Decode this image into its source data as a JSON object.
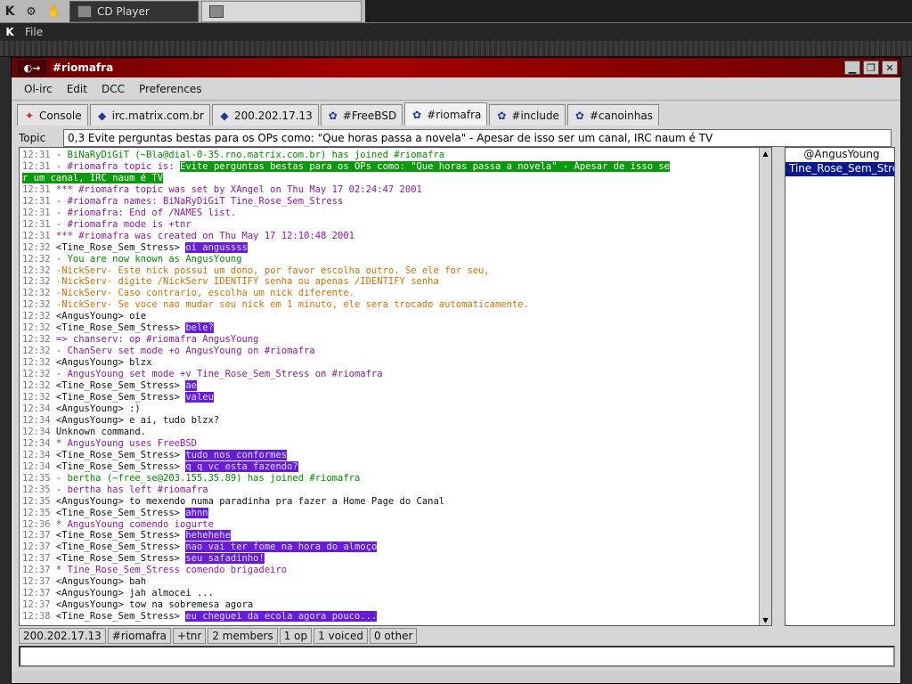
{
  "taskbar": {
    "k_label": "K",
    "tasks": [
      {
        "label": "CD Player"
      },
      {
        "label": ""
      }
    ]
  },
  "appbar": {
    "k_label": "K",
    "file_label": "File"
  },
  "window": {
    "title": "#riomafra",
    "menu": [
      "Ol-irc",
      "Edit",
      "DCC",
      "Preferences"
    ],
    "tabs": [
      {
        "label": "Console",
        "icon": "console-icon"
      },
      {
        "label": "irc.matrix.com.br",
        "icon": "server-icon"
      },
      {
        "label": "200.202.17.13",
        "icon": "server-icon"
      },
      {
        "label": "#FreeBSD",
        "icon": "channel-icon"
      },
      {
        "label": "#riomafra",
        "icon": "channel-icon",
        "active": true
      },
      {
        "label": "#include",
        "icon": "channel-icon"
      },
      {
        "label": "#canoinhas",
        "icon": "channel-icon"
      }
    ],
    "topic_label": "Topic",
    "topic": "0,3 Evite perguntas bestas para os OPs como: \"Que horas passa a novela\" - Apesar de isso ser um canal, IRC naum é TV"
  },
  "chat": [
    {
      "t": "12:31",
      "parts": [
        {
          "c": "green",
          "x": " - BiNaRyDiGiT (~Bla@dial-0-35.rno.matrix.com.br) has joined #riomafra"
        }
      ]
    },
    {
      "t": "12:31",
      "parts": [
        {
          "c": "purple",
          "x": " - #riomafra topic is: "
        },
        {
          "c": "greenbar",
          "x": " Evite perguntas bestas para os OPs como: \"Que horas passa a novela\" - Apesar de isso se"
        }
      ]
    },
    {
      "t": "",
      "parts": [
        {
          "c": "greenbar",
          "x": "r um canal, IRC naum é TV "
        }
      ]
    },
    {
      "t": "12:31",
      "parts": [
        {
          "c": "purple",
          "x": " *** #riomafra topic was set by XAngel on Thu May 17 02:24:47 2001"
        }
      ]
    },
    {
      "t": "12:31",
      "parts": [
        {
          "c": "purple",
          "x": " - #riomafra names: BiNaRyDiGiT Tine_Rose_Sem_Stress"
        }
      ]
    },
    {
      "t": "12:31",
      "parts": [
        {
          "c": "purple",
          "x": " - #riomafra: End of /NAMES list."
        }
      ]
    },
    {
      "t": "12:31",
      "parts": [
        {
          "c": "purple",
          "x": " - #riomafra mode is +tnr"
        }
      ]
    },
    {
      "t": "12:31",
      "parts": [
        {
          "c": "purple",
          "x": " *** #riomafra was created on Thu May 17 12:10:48 2001"
        }
      ]
    },
    {
      "t": "12:32",
      "parts": [
        {
          "c": "black",
          "x": " <Tine_Rose_Sem_Stress> "
        },
        {
          "c": "hl",
          "x": "oi angussss"
        }
      ]
    },
    {
      "t": "12:32",
      "parts": [
        {
          "c": "green",
          "x": " - You are now known as AngusYoung"
        }
      ]
    },
    {
      "t": "12:32",
      "parts": [
        {
          "c": "orange",
          "x": " -NickServ- Este nick possui um dono, por favor escolha outro. Se ele for seu,"
        }
      ]
    },
    {
      "t": "12:32",
      "parts": [
        {
          "c": "orange",
          "x": " -NickServ- digite /NickServ IDENTIFY senha ou apenas /IDENTIFY senha"
        }
      ]
    },
    {
      "t": "12:32",
      "parts": [
        {
          "c": "orange",
          "x": " -NickServ- Caso contrario, escolha um nick diferente."
        }
      ]
    },
    {
      "t": "12:32",
      "parts": [
        {
          "c": "orange",
          "x": " -NickServ- Se voce nao mudar seu nick em 1 minuto, ele sera trocado automaticamente."
        }
      ]
    },
    {
      "t": "12:32",
      "parts": [
        {
          "c": "black",
          "x": " <AngusYoung> oie"
        }
      ]
    },
    {
      "t": "12:32",
      "parts": [
        {
          "c": "black",
          "x": " <Tine_Rose_Sem_Stress> "
        },
        {
          "c": "hl",
          "x": "bele?"
        }
      ]
    },
    {
      "t": "12:32",
      "parts": [
        {
          "c": "purple",
          "x": " => chanserv: op #riomafra AngusYoung"
        }
      ]
    },
    {
      "t": "12:32",
      "parts": [
        {
          "c": "purple",
          "x": " - ChanServ set mode +o AngusYoung on #riomafra"
        }
      ]
    },
    {
      "t": "12:32",
      "parts": [
        {
          "c": "black",
          "x": " <AngusYoung> blzx"
        }
      ]
    },
    {
      "t": "12:32",
      "parts": [
        {
          "c": "purple",
          "x": " - AngusYoung set mode +v Tine_Rose_Sem_Stress on #riomafra"
        }
      ]
    },
    {
      "t": "12:32",
      "parts": [
        {
          "c": "black",
          "x": " <Tine_Rose_Sem_Stress> "
        },
        {
          "c": "hl",
          "x": "ae"
        }
      ]
    },
    {
      "t": "12:32",
      "parts": [
        {
          "c": "black",
          "x": " <Tine_Rose_Sem_Stress> "
        },
        {
          "c": "hl",
          "x": "valeu"
        }
      ]
    },
    {
      "t": "12:34",
      "parts": [
        {
          "c": "black",
          "x": " <AngusYoung> :)"
        }
      ]
    },
    {
      "t": "12:34",
      "parts": [
        {
          "c": "black",
          "x": " <AngusYoung> e ai, tudo blzx?"
        }
      ]
    },
    {
      "t": "12:34",
      "parts": [
        {
          "c": "black",
          "x": " Unknown command."
        }
      ]
    },
    {
      "t": "12:34",
      "parts": [
        {
          "c": "purple",
          "x": " * AngusYoung uses FreeBSD"
        }
      ]
    },
    {
      "t": "12:34",
      "parts": [
        {
          "c": "black",
          "x": " <Tine_Rose_Sem_Stress> "
        },
        {
          "c": "hl",
          "x": "tudo nos conformes"
        }
      ]
    },
    {
      "t": "12:34",
      "parts": [
        {
          "c": "black",
          "x": " <Tine_Rose_Sem_Stress> "
        },
        {
          "c": "hl",
          "x": "q q vc esta fazendo?"
        }
      ]
    },
    {
      "t": "12:35",
      "parts": [
        {
          "c": "green",
          "x": " - bertha (~free_se@203.155.35.89) has joined #riomafra"
        }
      ]
    },
    {
      "t": "12:35",
      "parts": [
        {
          "c": "purple",
          "x": " - bertha has left #riomafra"
        }
      ]
    },
    {
      "t": "12:35",
      "parts": [
        {
          "c": "black",
          "x": " <AngusYoung> to mexendo numa paradinha pra fazer a Home Page do Canal"
        }
      ]
    },
    {
      "t": "12:35",
      "parts": [
        {
          "c": "black",
          "x": " <Tine_Rose_Sem_Stress> "
        },
        {
          "c": "hl",
          "x": "ahnn"
        }
      ]
    },
    {
      "t": "12:36",
      "parts": [
        {
          "c": "purple",
          "x": " * AngusYoung comendo iogurte"
        }
      ]
    },
    {
      "t": "12:37",
      "parts": [
        {
          "c": "black",
          "x": " <Tine_Rose_Sem_Stress> "
        },
        {
          "c": "hl",
          "x": "hehehehe"
        }
      ]
    },
    {
      "t": "12:37",
      "parts": [
        {
          "c": "black",
          "x": " <Tine_Rose_Sem_Stress> "
        },
        {
          "c": "hl",
          "x": "nao vai ter fome na hora do almoço"
        }
      ]
    },
    {
      "t": "12:37",
      "parts": [
        {
          "c": "black",
          "x": " <Tine_Rose_Sem_Stress> "
        },
        {
          "c": "hl",
          "x": "seu safadinho!"
        }
      ]
    },
    {
      "t": "12:37",
      "parts": [
        {
          "c": "purple",
          "x": " * Tine_Rose_Sem_Stress comendo brigadeiro"
        }
      ]
    },
    {
      "t": "12:37",
      "parts": [
        {
          "c": "black",
          "x": " <AngusYoung> bah"
        }
      ]
    },
    {
      "t": "12:37",
      "parts": [
        {
          "c": "black",
          "x": " <AngusYoung> jah almocei ..."
        }
      ]
    },
    {
      "t": "12:37",
      "parts": [
        {
          "c": "black",
          "x": " <AngusYoung> tow na sobremesa agora"
        }
      ]
    },
    {
      "t": "12:38",
      "parts": [
        {
          "c": "black",
          "x": " <Tine_Rose_Sem_Stress> "
        },
        {
          "c": "hl",
          "x": "eu cheguei da ecola agora pouco..."
        }
      ]
    }
  ],
  "nicklist": [
    {
      "name": "@AngusYoung",
      "selected": false
    },
    {
      "name": "Tine_Rose_Sem_Stres",
      "selected": true
    }
  ],
  "status": [
    "200.202.17.13",
    "#riomafra",
    "+tnr",
    "2 members",
    "1 op",
    "1 voiced",
    "0 other"
  ],
  "input": {
    "value": ""
  }
}
